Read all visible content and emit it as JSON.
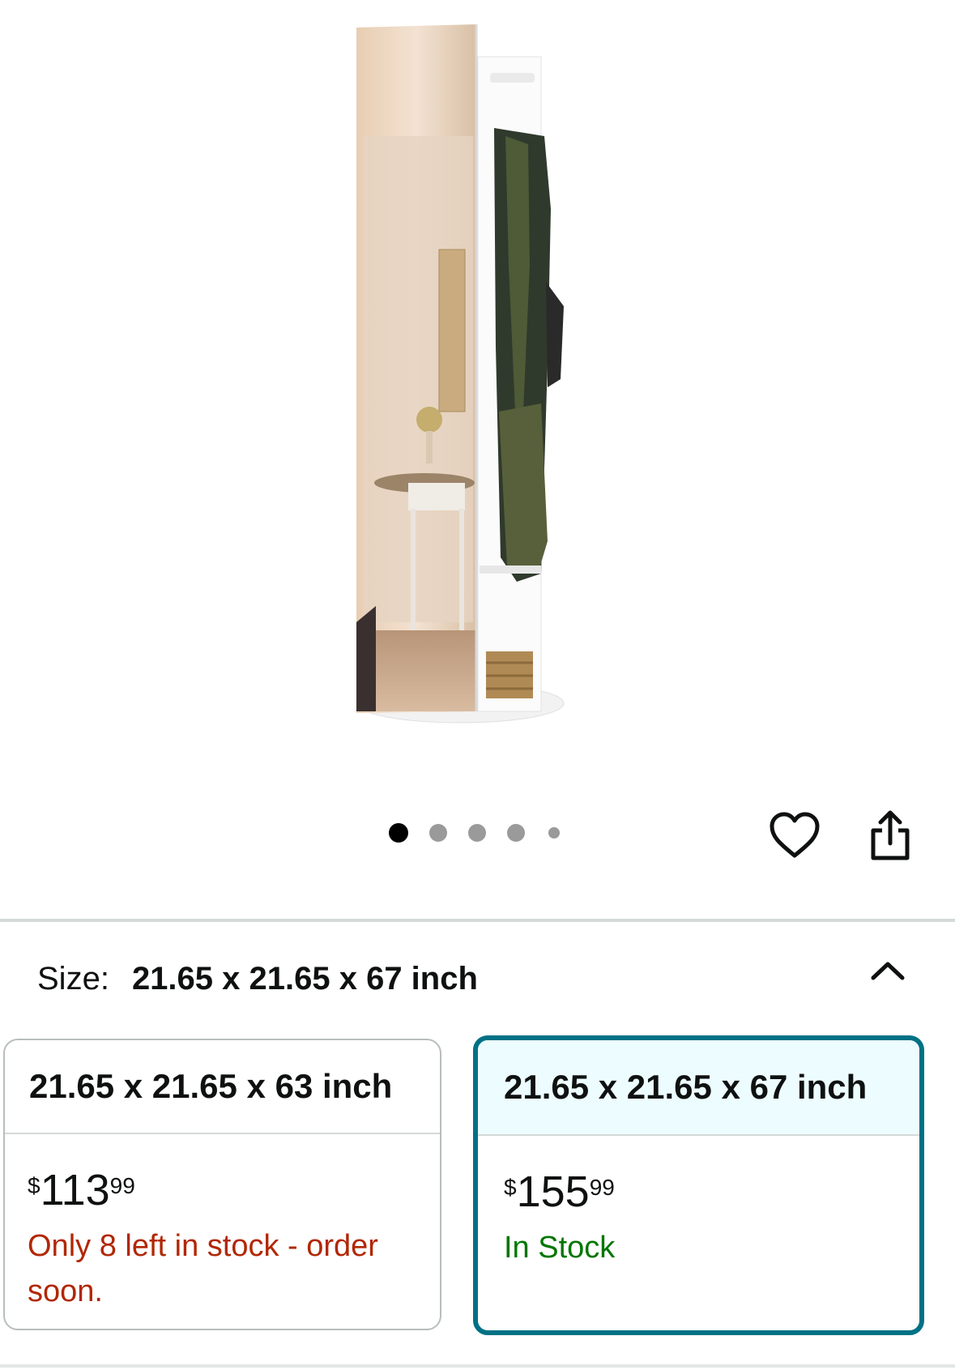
{
  "carousel": {
    "image_alt": "Rotating full-length mirror with clothes rack storage",
    "dot_count": 5,
    "active_index": 0
  },
  "actions": {
    "favorite_icon": "heart-outline-icon",
    "share_icon": "share-upload-icon"
  },
  "size": {
    "label": "Size:",
    "selected": "21.65 x 21.65 x 67 inch",
    "collapse_icon": "chevron-up-icon"
  },
  "options": [
    {
      "name": "21.65 x 21.65 x 63 inch",
      "price_symbol": "$",
      "price_whole": "113",
      "price_fraction": "99",
      "stock": "Only 8 left in stock - order soon.",
      "stock_color": "#b12704",
      "selected": false
    },
    {
      "name": "21.65 x 21.65 x 67 inch",
      "price_symbol": "$",
      "price_whole": "155",
      "price_fraction": "99",
      "stock": "In Stock",
      "stock_color": "#007600",
      "selected": true
    }
  ],
  "colors": {
    "selected_border": "#007185",
    "selected_header_bg": "#edfdff",
    "low_stock": "#b12704",
    "in_stock": "#007600"
  }
}
